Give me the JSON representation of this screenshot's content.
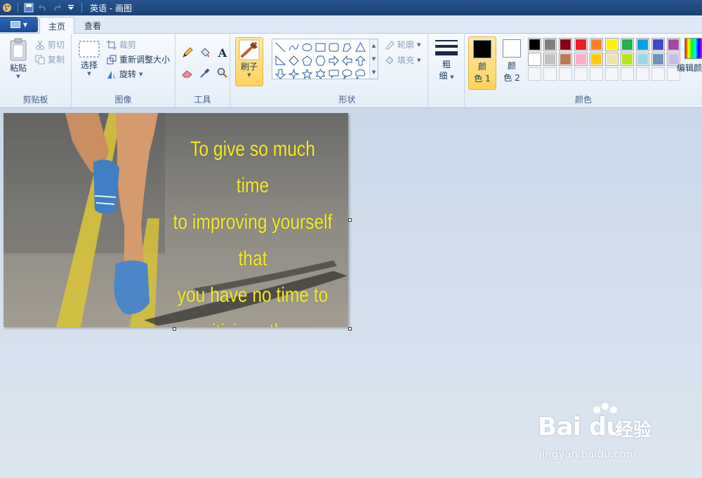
{
  "window": {
    "title": "英语 - 画图"
  },
  "tabs": [
    {
      "label": "主页",
      "active": true
    },
    {
      "label": "查看",
      "active": false
    }
  ],
  "clipboard": {
    "paste_label": "粘贴",
    "cut_label": "剪切",
    "copy_label": "复制",
    "group_label": "剪贴板"
  },
  "image_group": {
    "select_label": "选择",
    "crop_label": "裁剪",
    "resize_label": "重新调整大小",
    "rotate_label": "旋转",
    "group_label": "图像"
  },
  "tools": {
    "group_label": "工具",
    "items": [
      "pencil-icon",
      "fill-bucket-icon",
      "text-icon",
      "eraser-icon",
      "color-picker-icon",
      "magnifier-icon"
    ]
  },
  "brushes": {
    "label": "刷子"
  },
  "shapes": {
    "group_label": "形状",
    "outline_label": "轮廓",
    "fill_label": "填充",
    "items": [
      "line",
      "curve",
      "oval",
      "rectangle",
      "rounded-rectangle",
      "polygon",
      "triangle",
      "right-triangle",
      "diamond",
      "pentagon",
      "hexagon",
      "right-arrow",
      "left-arrow",
      "up-arrow",
      "down-arrow",
      "four-point-star",
      "five-point-star",
      "six-point-star",
      "rounded-callout",
      "oval-callout",
      "cloud-callout"
    ]
  },
  "size": {
    "label_line1": "粗",
    "label_line2": "细"
  },
  "colors": {
    "group_label": "颜色",
    "color1": {
      "line1": "颜",
      "line2": "色 1",
      "value": "#000000"
    },
    "color2": {
      "line1": "颜",
      "line2": "色 2",
      "value": "#ffffff"
    },
    "edit_label": "编辑颜色",
    "palette_row1": [
      "#000000",
      "#7f7f7f",
      "#880015",
      "#ed1c24",
      "#ff7f27",
      "#fff200",
      "#22b14c",
      "#00a2e8",
      "#3f48cc",
      "#a349a4"
    ],
    "palette_row2": [
      "#ffffff",
      "#c3c3c3",
      "#b97a57",
      "#ffaec9",
      "#ffc90e",
      "#efe4b0",
      "#b5e61d",
      "#99d9ea",
      "#7092be",
      "#c8bfe7"
    ],
    "palette_row3": [
      "#f0f0f0",
      "#f0f0f0",
      "#f0f0f0",
      "#f0f0f0",
      "#f0f0f0",
      "#f0f0f0",
      "#f0f0f0",
      "#f0f0f0",
      "#f0f0f0",
      "#f0f0f0"
    ]
  },
  "canvas": {
    "quote_lines": [
      "To give so much time",
      "to improving yourself that",
      "you have no time to",
      "criticize others"
    ]
  },
  "watermark": {
    "logo": "Bai du",
    "text": "经验",
    "url": "jingyan.baidu.com"
  }
}
